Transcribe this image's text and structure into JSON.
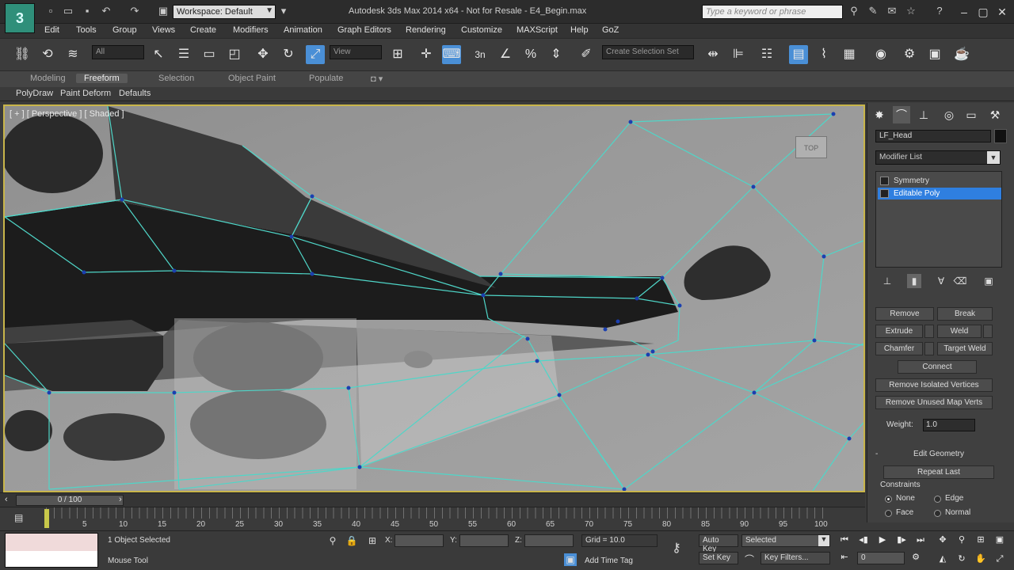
{
  "titlebar": {
    "logo": "3",
    "workspace": "Workspace: Default",
    "title": "Autodesk 3ds Max  2014 x64    - Not for Resale -   E4_Begin.max",
    "search_placeholder": "Type a keyword or phrase"
  },
  "menu": [
    "Edit",
    "Tools",
    "Group",
    "Views",
    "Create",
    "Modifiers",
    "Animation",
    "Graph Editors",
    "Rendering",
    "Customize",
    "MAXScript",
    "Help",
    "GoZ"
  ],
  "toolbar": {
    "selection_filter": "All",
    "reference_coord": "View",
    "named_selection": "Create Selection Set",
    "snap_3": "3n"
  },
  "ribbon": {
    "tabs": [
      "Modeling",
      "Freeform",
      "Selection",
      "Object Paint",
      "Populate"
    ],
    "active_tab": "Freeform",
    "subtabs": [
      "PolyDraw",
      "Paint Deform",
      "Defaults"
    ]
  },
  "viewport": {
    "label": "[ + ] [ Perspective ] [ Shaded ]",
    "viewcube_label": "TOP"
  },
  "command_panel": {
    "object_name": "LF_Head",
    "modifier_list": "Modifier List",
    "stack": [
      "Symmetry",
      "Editable Poly"
    ],
    "buttons": {
      "remove": "Remove",
      "break": "Break",
      "extrude": "Extrude",
      "weld": "Weld",
      "chamfer": "Chamfer",
      "target_weld": "Target Weld",
      "connect": "Connect",
      "remove_isolated": "Remove Isolated Vertices",
      "remove_unused": "Remove Unused Map Verts",
      "edit_geometry": "Edit Geometry",
      "repeat_last": "Repeat Last"
    },
    "weight_label": "Weight:",
    "weight_value": "1.0",
    "constraints_label": "Constraints",
    "constraints": [
      {
        "label": "None",
        "selected": true
      },
      {
        "label": "Edge",
        "selected": false
      },
      {
        "label": "Face",
        "selected": false
      },
      {
        "label": "Normal",
        "selected": false
      }
    ]
  },
  "timeline": {
    "thumb": "0 / 100",
    "ticks": [
      "5",
      "10",
      "15",
      "20",
      "25",
      "30",
      "35",
      "40",
      "45",
      "50",
      "55",
      "60",
      "65",
      "70",
      "75",
      "80",
      "85",
      "90",
      "95",
      "100"
    ]
  },
  "status": {
    "selection": "1 Object Selected",
    "prompt": "Mouse Tool",
    "x_label": "X:",
    "y_label": "Y:",
    "z_label": "Z:",
    "grid": "Grid = 10.0",
    "auto_key": "Auto Key",
    "set_key": "Set Key",
    "key_mode": "Selected",
    "key_filters": "Key Filters...",
    "add_time_tag": "Add Time Tag",
    "frame": "0"
  },
  "colors": {
    "accent": "#4a8fd6",
    "viewport_border": "#c8b54a",
    "wire": "#4fd6c8",
    "stack_selected": "#2f7fe0"
  }
}
